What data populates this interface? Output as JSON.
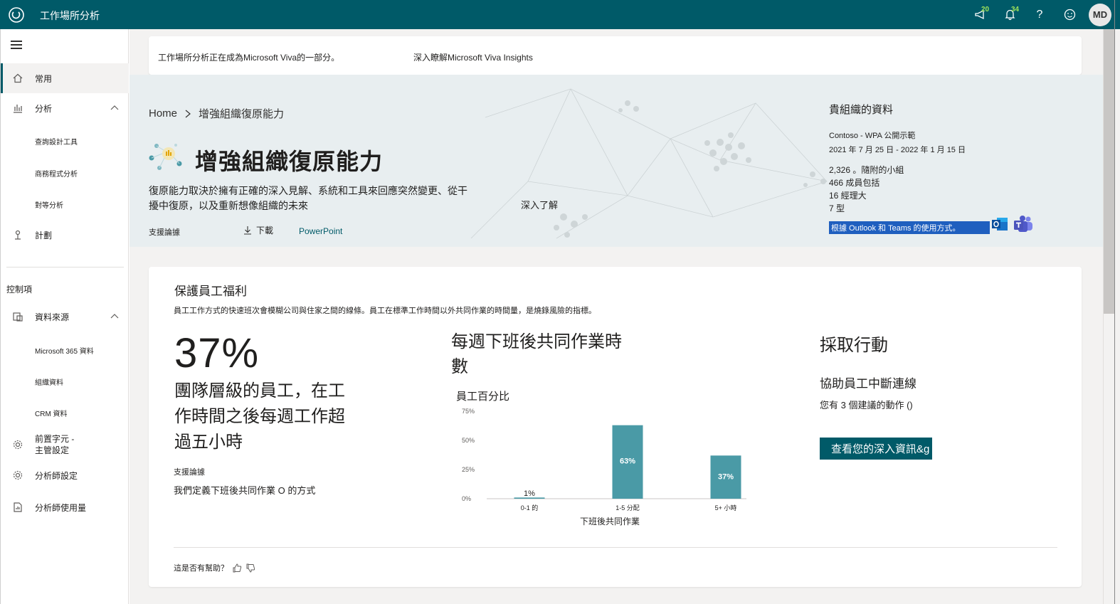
{
  "app": {
    "title": "工作場所分析"
  },
  "topbar": {
    "announcements_badge": "20",
    "notifications_badge": "34",
    "help_label": "?",
    "avatar_initials": "MD"
  },
  "sidebar": {
    "items": [
      {
        "label": "常用",
        "icon": "home-icon",
        "active": true
      },
      {
        "label": "分析",
        "icon": "analyze-icon",
        "expanded": true
      },
      {
        "label": "查詢設計工具",
        "sub": true
      },
      {
        "label": "商務程式分析",
        "sub": true
      },
      {
        "label": "對等分析",
        "sub": true
      },
      {
        "label": "計劃",
        "icon": "plan-icon"
      }
    ],
    "section_label": "控制項",
    "controls": [
      {
        "label": "資料來源",
        "icon": "data-source-icon",
        "expanded": true
      },
      {
        "label": "Microsoft 365 資料",
        "sub": true
      },
      {
        "label": "組織資料",
        "sub": true
      },
      {
        "label": "CRM 資料",
        "sub": true
      },
      {
        "label_line1": "前置字元 -",
        "label_line2": "主管設定",
        "icon": "gear-icon"
      },
      {
        "label": "分析師設定",
        "icon": "gear-icon"
      },
      {
        "label": "分析師使用量",
        "icon": "report-icon"
      }
    ]
  },
  "banner": {
    "text": "工作場所分析正在成為Microsoft Viva的一部分。",
    "link": "深入瞭解Microsoft Viva Insights"
  },
  "hero": {
    "breadcrumb_home": "Home",
    "breadcrumb_current": "增強組織復原能力",
    "title": "增強組織復原能力",
    "description": "復原能力取決於擁有正確的深入見解、系統和工具來回應突然變更、從干擾中復原，以及重新想像組織的未來",
    "learn_more": "深入了解",
    "support_label": "支援論據",
    "download_label": "下載",
    "powerpoint_label": "PowerPoint"
  },
  "org": {
    "title": "貴組織的資料",
    "name": "Contoso - WPA 公開示範",
    "date_range": "2021 年 7 月 25 日 - 2022 年 1 月 15 日",
    "stats": [
      "2,326 。隨附的小組",
      "466 成員包括",
      "16 經理大",
      "7 型"
    ],
    "usage_link": "根據 Outlook 和 Teams 的使用方式。"
  },
  "card": {
    "title": "保護員工福利",
    "description": "員工工作方式的快速班次會模糊公司與住家之間的線條。員工在標準工作時間以外共同作業的時間量，是燒錄風險的指標。",
    "big_percent": "37%",
    "big_desc": "團隊層級的員工，在工作時間之後每週工作超過五小時",
    "support_label": "支援論據",
    "define_link": "我們定義下班後共同作業 O 的方式",
    "action_title": "採取行動",
    "action_sub": "協助員工中斷連線",
    "action_count": "您有 3 個建議的動作 ()",
    "action_button": "查看您的深入資訊&g",
    "helpful": "這是否有幫助？"
  },
  "chart_data": {
    "type": "bar",
    "title": "每週下班後共同作業時數",
    "ylabel": "員工百分比",
    "xlabel": "下班後共同作業",
    "categories": [
      "0-1 的",
      "1-5 分配",
      "5+ 小時"
    ],
    "values": [
      1,
      63,
      37
    ],
    "value_labels": [
      "1%",
      "63%",
      "37%"
    ],
    "yticks": [
      "0%",
      "25%",
      "50%",
      "75%"
    ],
    "ylim": [
      0,
      75
    ],
    "color": "#4a9aa6",
    "grid": false
  },
  "colors": {
    "accent": "#005a68",
    "bar": "#4a9aa6",
    "link_highlight": "#1f5fbf"
  }
}
